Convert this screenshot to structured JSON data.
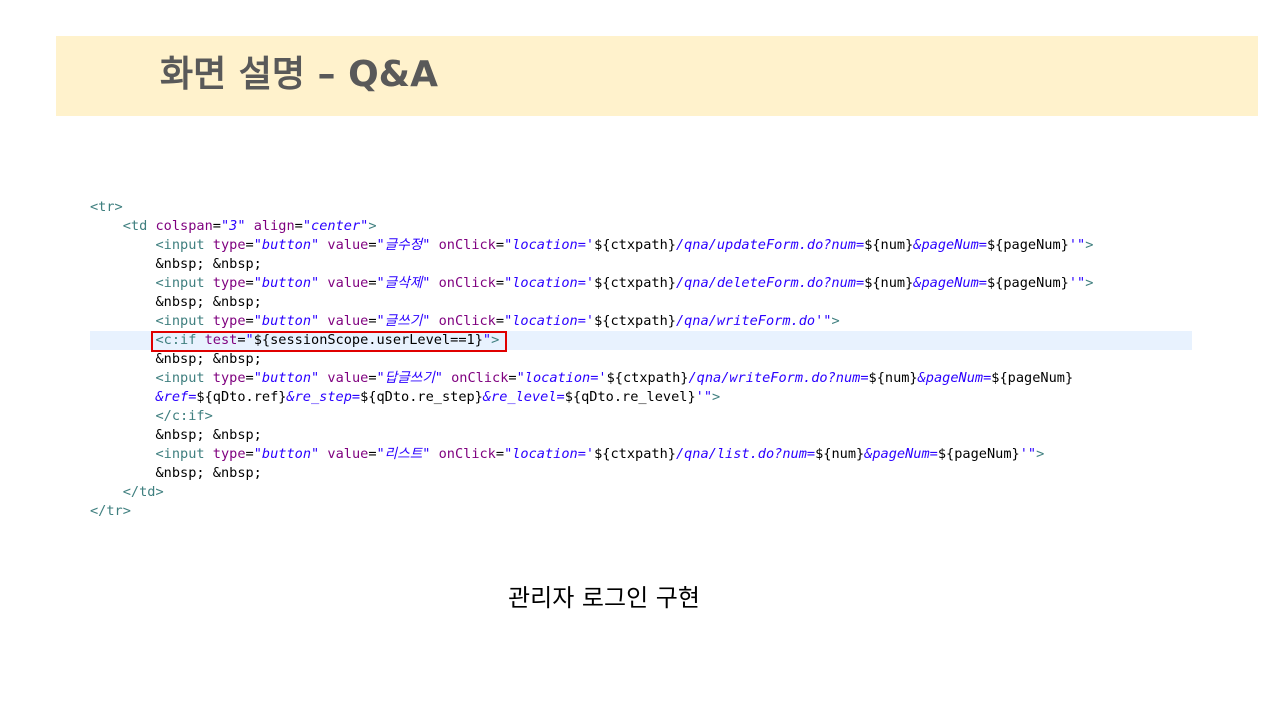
{
  "slide": {
    "title": "화면 설명 – Q&A",
    "caption": "관리자 로그인 구현",
    "colors": {
      "title_band": "#fff2cc",
      "title_text": "#595959",
      "highlight_border": "#e00000",
      "current_line": "#e8f2fe"
    }
  },
  "code": {
    "highlighted_line": 7,
    "lines": [
      [
        [
          "tag",
          "<tr>"
        ]
      ],
      [
        [
          "text",
          "    "
        ],
        [
          "tag",
          "<td "
        ],
        [
          "attr",
          "colspan"
        ],
        [
          "text",
          "="
        ],
        [
          "val",
          "\"3\""
        ],
        [
          "text",
          " "
        ],
        [
          "attr",
          "align"
        ],
        [
          "text",
          "="
        ],
        [
          "val",
          "\"center\""
        ],
        [
          "tag",
          ">"
        ]
      ],
      [
        [
          "text",
          "        "
        ],
        [
          "tag",
          "<input "
        ],
        [
          "attr",
          "type"
        ],
        [
          "text",
          "="
        ],
        [
          "val",
          "\"button\""
        ],
        [
          "text",
          " "
        ],
        [
          "attr",
          "value"
        ],
        [
          "text",
          "="
        ],
        [
          "val",
          "\"글수정\""
        ],
        [
          "text",
          " "
        ],
        [
          "attr",
          "onClick"
        ],
        [
          "text",
          "="
        ],
        [
          "val",
          "\"location='"
        ],
        [
          "text",
          "${ctxpath}"
        ],
        [
          "val",
          "/qna/updateForm.do?num="
        ],
        [
          "text",
          "${num}"
        ],
        [
          "val",
          "&pageNum="
        ],
        [
          "text",
          "${pageNum}"
        ],
        [
          "val",
          "'\""
        ],
        [
          "tag",
          ">"
        ]
      ],
      [
        [
          "text",
          "        &nbsp; &nbsp;"
        ]
      ],
      [
        [
          "text",
          "        "
        ],
        [
          "tag",
          "<input "
        ],
        [
          "attr",
          "type"
        ],
        [
          "text",
          "="
        ],
        [
          "val",
          "\"button\""
        ],
        [
          "text",
          " "
        ],
        [
          "attr",
          "value"
        ],
        [
          "text",
          "="
        ],
        [
          "val",
          "\"글삭제\""
        ],
        [
          "text",
          " "
        ],
        [
          "attr",
          "onClick"
        ],
        [
          "text",
          "="
        ],
        [
          "val",
          "\"location='"
        ],
        [
          "text",
          "${ctxpath}"
        ],
        [
          "val",
          "/qna/deleteForm.do?num="
        ],
        [
          "text",
          "${num}"
        ],
        [
          "val",
          "&pageNum="
        ],
        [
          "text",
          "${pageNum}"
        ],
        [
          "val",
          "'\""
        ],
        [
          "tag",
          ">"
        ]
      ],
      [
        [
          "text",
          "        &nbsp; &nbsp;"
        ]
      ],
      [
        [
          "text",
          "        "
        ],
        [
          "tag",
          "<input "
        ],
        [
          "attr",
          "type"
        ],
        [
          "text",
          "="
        ],
        [
          "val",
          "\"button\""
        ],
        [
          "text",
          " "
        ],
        [
          "attr",
          "value"
        ],
        [
          "text",
          "="
        ],
        [
          "val",
          "\"글쓰기\""
        ],
        [
          "text",
          " "
        ],
        [
          "attr",
          "onClick"
        ],
        [
          "text",
          "="
        ],
        [
          "val",
          "\"location='"
        ],
        [
          "text",
          "${ctxpath}"
        ],
        [
          "val",
          "/qna/writeForm.do'\""
        ],
        [
          "tag",
          ">"
        ]
      ],
      [
        [
          "text",
          "        "
        ],
        [
          "tag",
          "<c:if "
        ],
        [
          "attr",
          "test"
        ],
        [
          "text",
          "="
        ],
        [
          "val",
          "\""
        ],
        [
          "text",
          "${sessionScope.userLevel==1}"
        ],
        [
          "val",
          "\""
        ],
        [
          "tag",
          ">"
        ]
      ],
      [
        [
          "text",
          "        &nbsp; &nbsp;"
        ]
      ],
      [
        [
          "text",
          "        "
        ],
        [
          "tag",
          "<input "
        ],
        [
          "attr",
          "type"
        ],
        [
          "text",
          "="
        ],
        [
          "val",
          "\"button\""
        ],
        [
          "text",
          " "
        ],
        [
          "attr",
          "value"
        ],
        [
          "text",
          "="
        ],
        [
          "val",
          "\"답글쓰기\""
        ],
        [
          "text",
          " "
        ],
        [
          "attr",
          "onClick"
        ],
        [
          "text",
          "="
        ],
        [
          "val",
          "\"location='"
        ],
        [
          "text",
          "${ctxpath}"
        ],
        [
          "val",
          "/qna/writeForm.do?num="
        ],
        [
          "text",
          "${num}"
        ],
        [
          "val",
          "&pageNum="
        ],
        [
          "text",
          "${pageNum}"
        ]
      ],
      [
        [
          "text",
          "        "
        ],
        [
          "val",
          "&ref="
        ],
        [
          "text",
          "${qDto.ref}"
        ],
        [
          "val",
          "&re_step="
        ],
        [
          "text",
          "${qDto.re_step}"
        ],
        [
          "val",
          "&re_level="
        ],
        [
          "text",
          "${qDto.re_level}"
        ],
        [
          "val",
          "'\""
        ],
        [
          "tag",
          ">"
        ]
      ],
      [
        [
          "text",
          "        "
        ],
        [
          "tag",
          "</c:if>"
        ]
      ],
      [
        [
          "text",
          "        &nbsp; &nbsp;"
        ]
      ],
      [
        [
          "text",
          "        "
        ],
        [
          "tag",
          "<input "
        ],
        [
          "attr",
          "type"
        ],
        [
          "text",
          "="
        ],
        [
          "val",
          "\"button\""
        ],
        [
          "text",
          " "
        ],
        [
          "attr",
          "value"
        ],
        [
          "text",
          "="
        ],
        [
          "val",
          "\"리스트\""
        ],
        [
          "text",
          " "
        ],
        [
          "attr",
          "onClick"
        ],
        [
          "text",
          "="
        ],
        [
          "val",
          "\"location='"
        ],
        [
          "text",
          "${ctxpath}"
        ],
        [
          "val",
          "/qna/list.do?num="
        ],
        [
          "text",
          "${num}"
        ],
        [
          "val",
          "&pageNum="
        ],
        [
          "text",
          "${pageNum}"
        ],
        [
          "val",
          "'\""
        ],
        [
          "tag",
          ">"
        ]
      ],
      [
        [
          "text",
          "        &nbsp; &nbsp;"
        ]
      ],
      [
        [
          "text",
          "    "
        ],
        [
          "tag",
          "</td>"
        ]
      ],
      [
        [
          "tag",
          "</tr>"
        ]
      ]
    ]
  }
}
